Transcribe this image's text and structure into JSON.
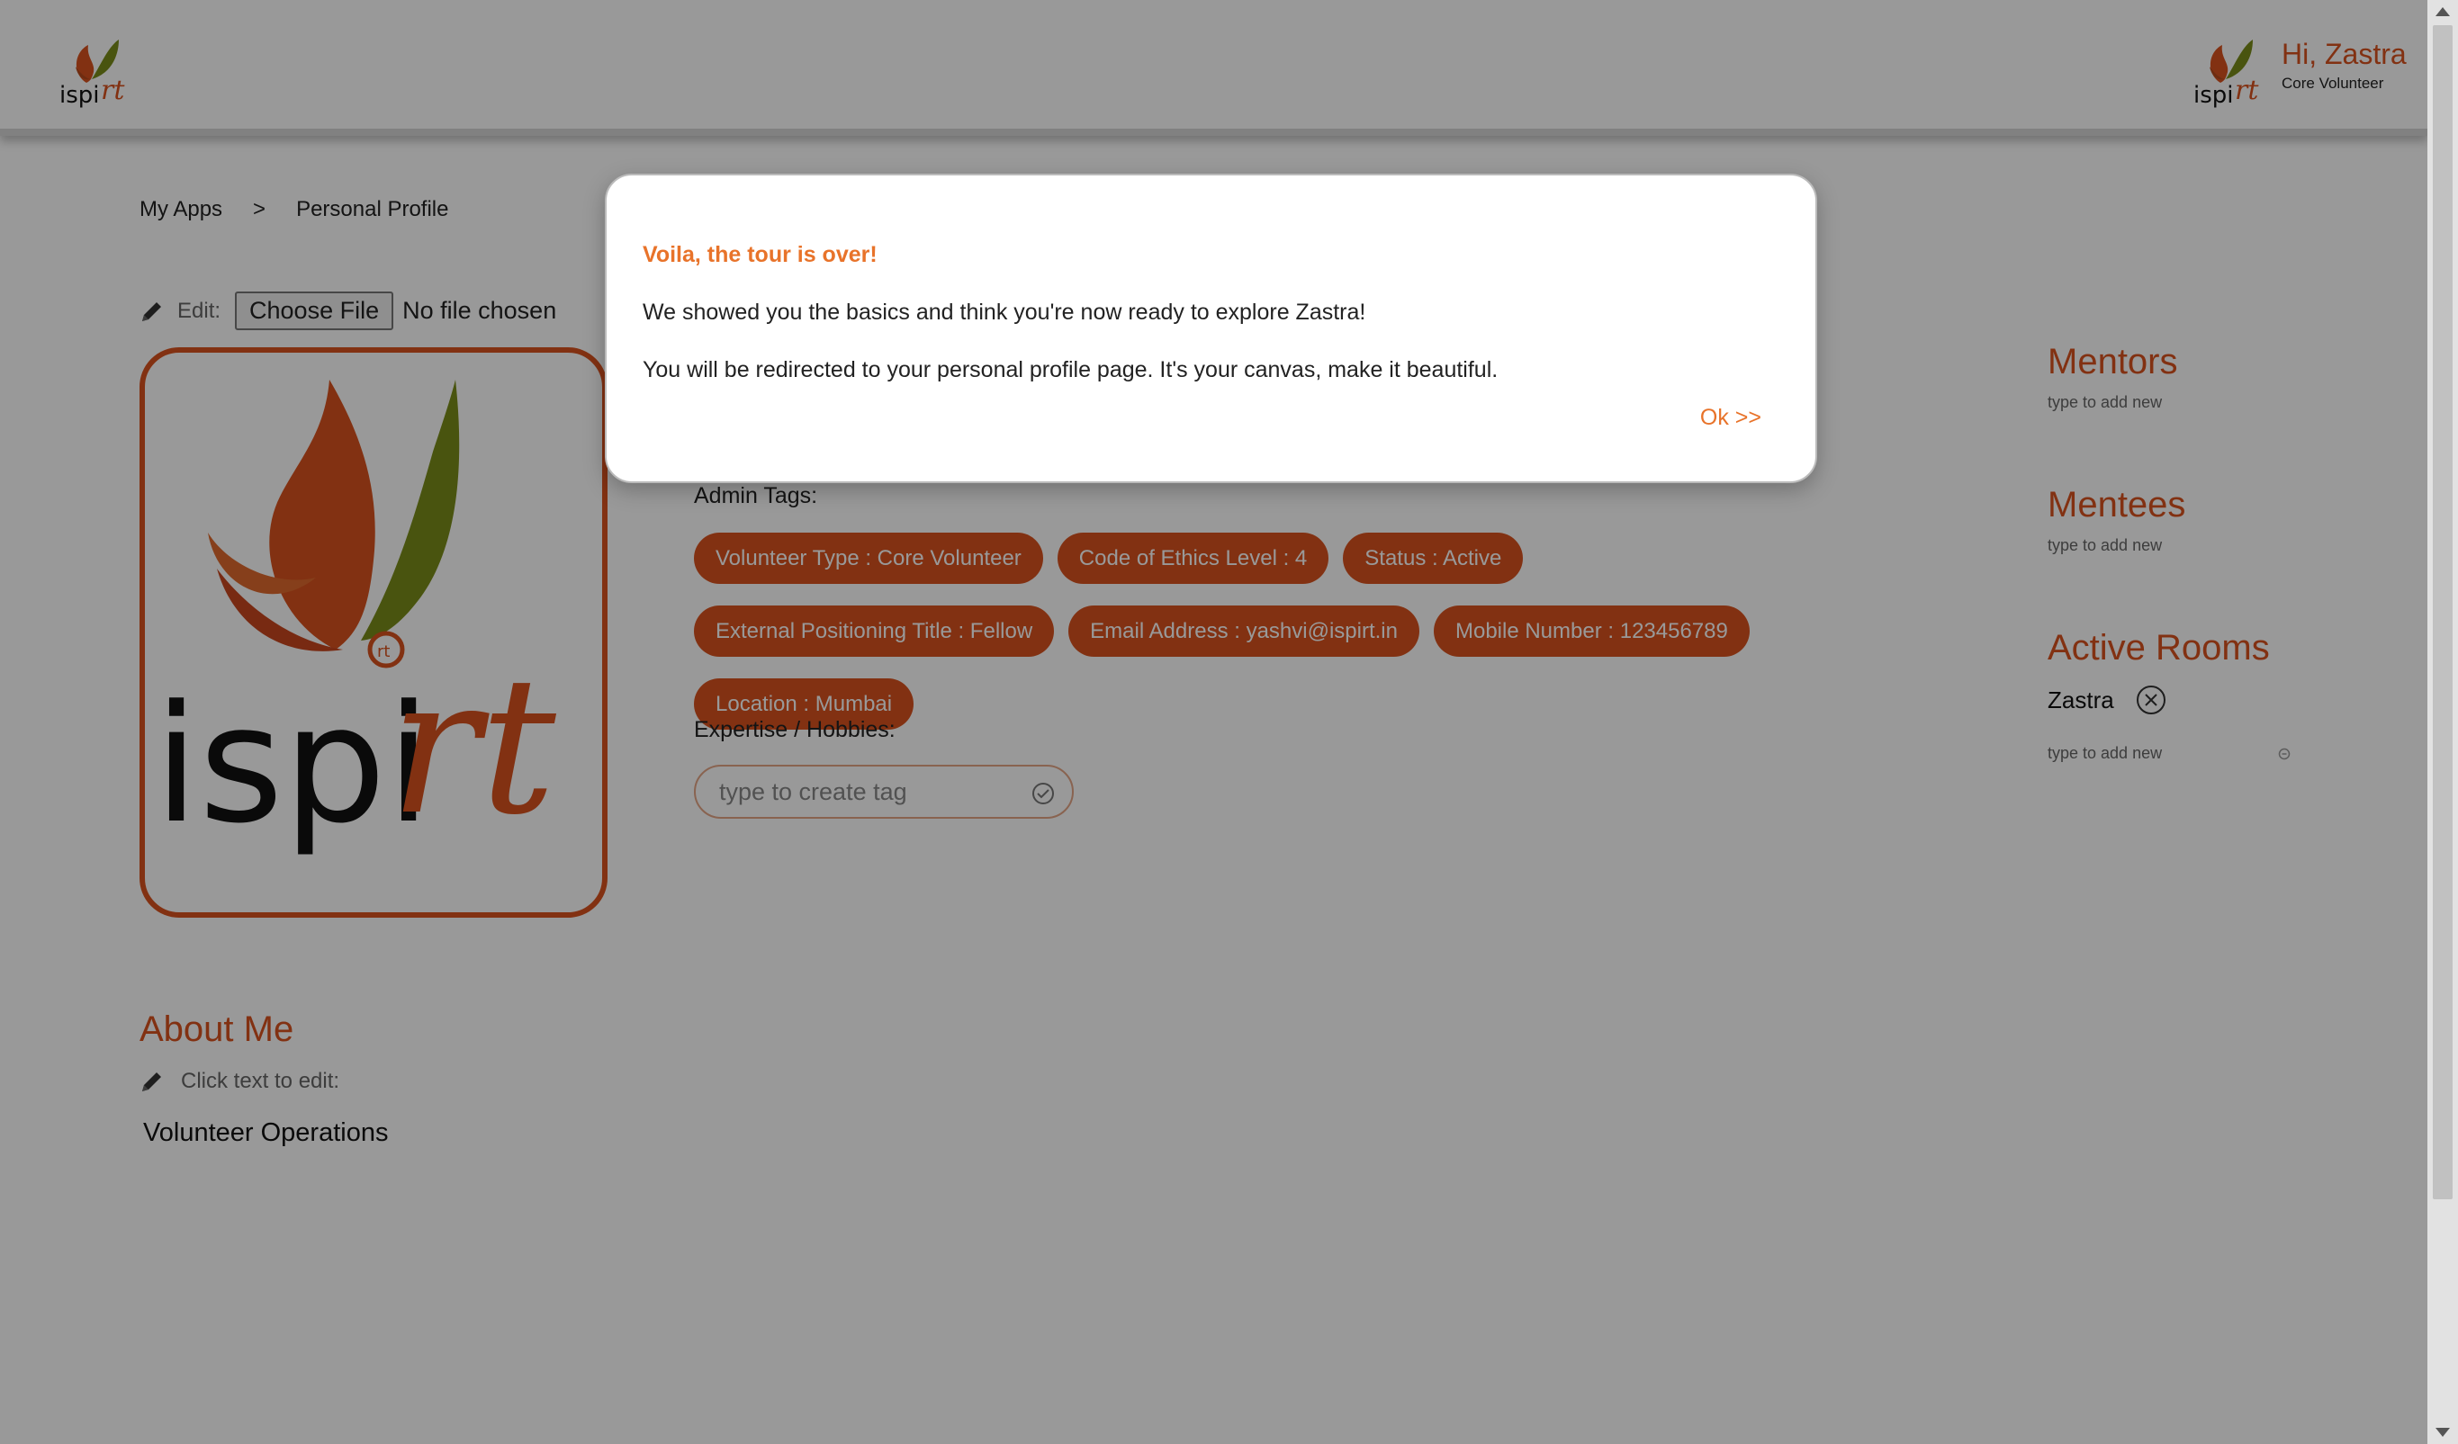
{
  "header": {
    "greeting": "Hi, Zastra",
    "role": "Core Volunteer",
    "logo_name": "ispirt-logo"
  },
  "breadcrumb": {
    "items": [
      "My Apps",
      "Personal Profile"
    ],
    "separator": ">"
  },
  "photo_edit": {
    "label": "Edit:",
    "button_label": "Choose File",
    "status": "No file chosen"
  },
  "about": {
    "title": "About Me",
    "edit_hint": "Click text to edit:",
    "text": "Volunteer Operations"
  },
  "admin_tags": {
    "label": "Admin Tags:",
    "items": [
      "Volunteer Type : Core Volunteer",
      "Code of Ethics Level : 4",
      "Status : Active",
      "External Positioning Title : Fellow",
      "Email Address : yashvi@ispirt.in",
      "Mobile Number : 123456789",
      "Location : Mumbai"
    ]
  },
  "expertise": {
    "label": "Expertise / Hobbies:",
    "placeholder": "type to create tag"
  },
  "sidebar": {
    "mentors": {
      "title": "Mentors",
      "placeholder": "type to add new"
    },
    "mentees": {
      "title": "Mentees",
      "placeholder": "type to add new"
    },
    "active_rooms": {
      "title": "Active Rooms",
      "rooms": [
        "Zastra"
      ],
      "placeholder": "type to add new"
    }
  },
  "modal": {
    "title": "Voila, the tour is over!",
    "line1": "We showed you the basics and think you're now ready to explore Zastra!",
    "line2": "You will be redirected to your personal profile page. It's your canvas, make it beautiful.",
    "ok_label": "Ok >>"
  },
  "colors": {
    "accent": "#d9531e",
    "modal_accent": "#e8732a",
    "overlay": "rgba(0,0,0,0.4)"
  }
}
